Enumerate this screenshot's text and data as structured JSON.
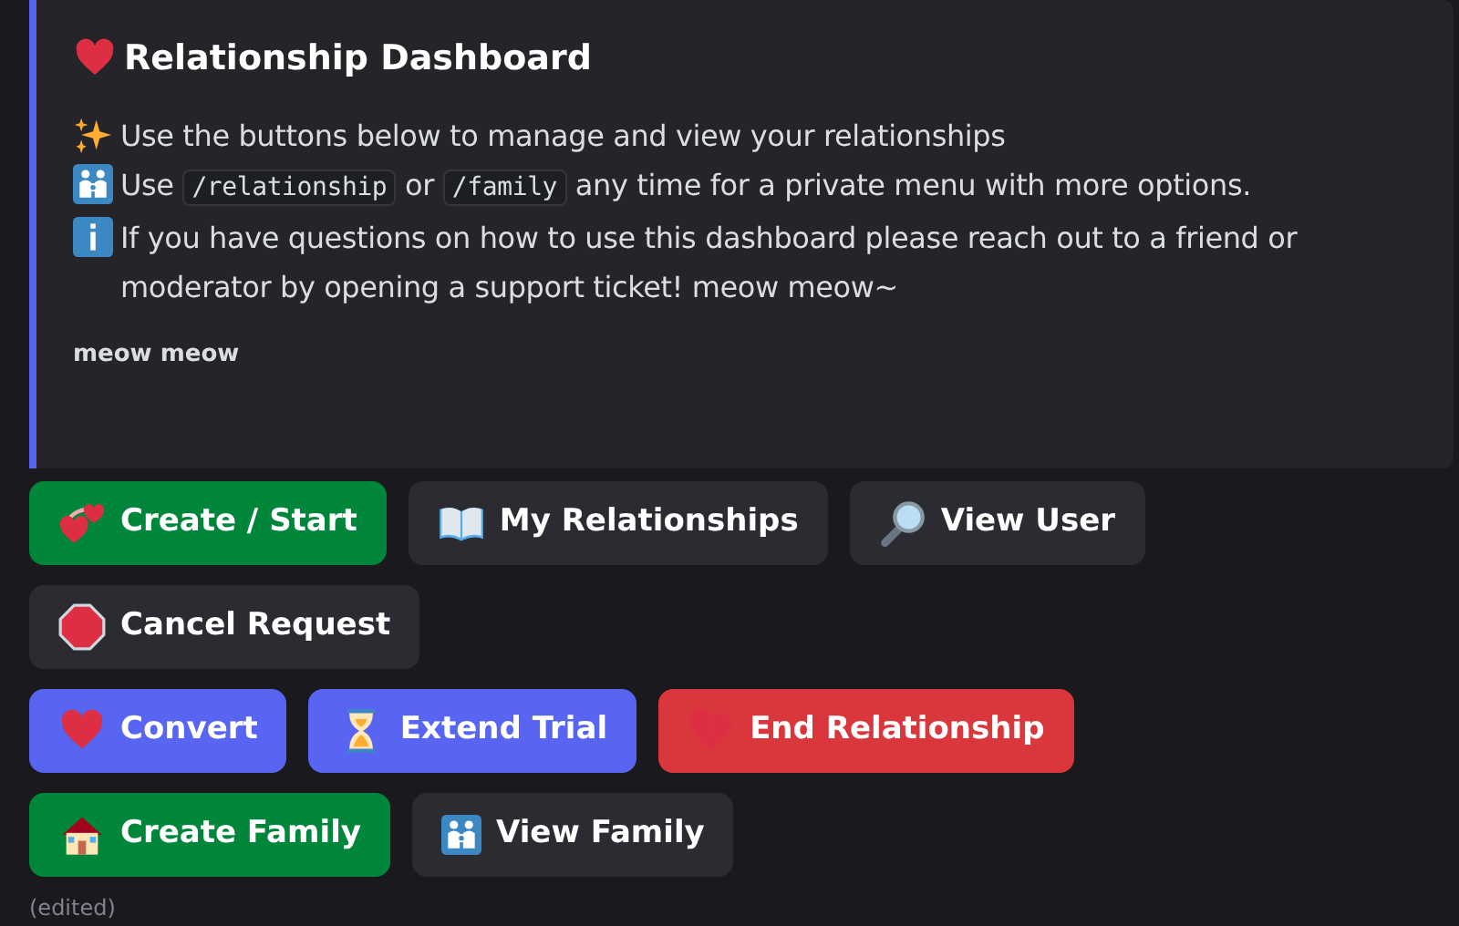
{
  "embed": {
    "title": "Relationship Dashboard",
    "lines": [
      {
        "segments": [
          {
            "kind": "text",
            "text": "Use the buttons below to manage and view your relationships"
          }
        ]
      },
      {
        "segments": [
          {
            "kind": "text",
            "text": "Use "
          },
          {
            "kind": "code",
            "text": "/relationship"
          },
          {
            "kind": "text",
            "text": " or "
          },
          {
            "kind": "code",
            "text": "/family"
          },
          {
            "kind": "text",
            "text": " any time for a private menu with more options."
          }
        ]
      },
      {
        "segments": [
          {
            "kind": "text",
            "text": "If you have questions on how to use this dashboard please reach out to a friend or moderator by opening a support ticket! meow meow~"
          }
        ]
      }
    ],
    "footer": "meow meow"
  },
  "button_rows": [
    [
      {
        "label": "Create / Start",
        "kind": "success"
      },
      {
        "label": "My Relationships",
        "kind": "secondary"
      },
      {
        "label": "View User",
        "kind": "secondary"
      }
    ],
    [
      {
        "label": "Cancel Request",
        "kind": "secondary"
      }
    ],
    [
      {
        "label": "Convert",
        "kind": "primary"
      },
      {
        "label": "Extend Trial",
        "kind": "primary"
      },
      {
        "label": "End Relationship",
        "kind": "danger"
      }
    ],
    [
      {
        "label": "Create Family",
        "kind": "success"
      },
      {
        "label": "View Family",
        "kind": "secondary"
      }
    ]
  ],
  "edited": "(edited)"
}
